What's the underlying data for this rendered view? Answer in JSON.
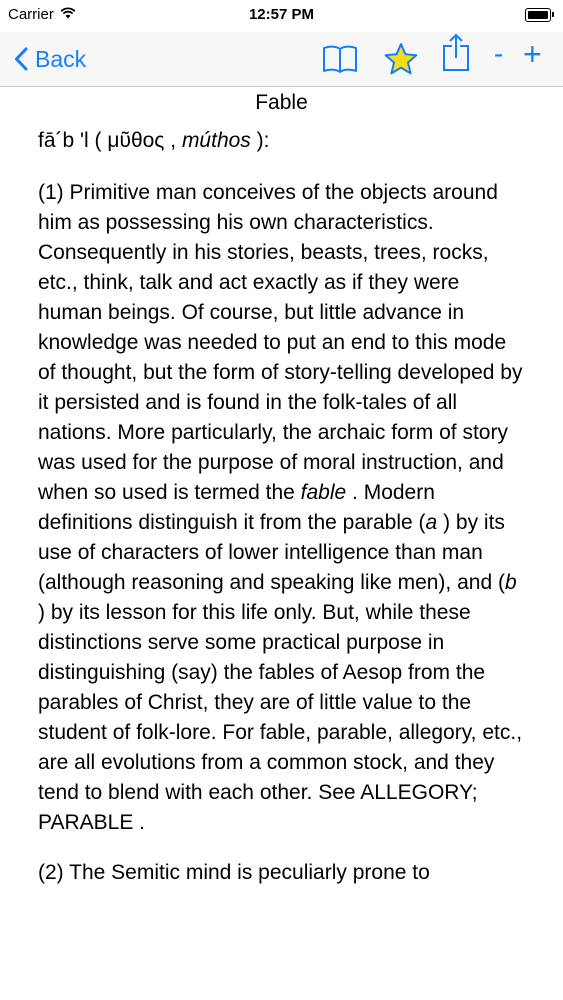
{
  "status_bar": {
    "carrier": "Carrier",
    "time": "12:57 PM"
  },
  "nav": {
    "back_label": "Back",
    "zoom_out": "-",
    "zoom_in": "+"
  },
  "entry": {
    "title": "Fable",
    "pronunciation": {
      "text": "fā´b 'l ( μῦθος , ",
      "italic": "múthos",
      "end": " ):"
    },
    "p1": {
      "part1": "(1) Primitive man conceives of the objects around him as possessing his own characteristics. Consequently in his stories, beasts, trees, rocks, etc., think, talk and act exactly as if they were human beings. Of course, but little advance in knowledge was needed to put an end to this mode of thought, but the form of story-telling developed by it persisted and is found in the folk-tales of all nations. More particularly, the archaic form of story was used for the purpose of moral instruction, and when so used is termed the ",
      "fable": "fable",
      "part2": " . Modern definitions distinguish it from the parable (",
      "a": "a",
      "part3": " ) by its use of characters of lower intelligence than man (although reasoning and speaking like men), and (",
      "b": "b",
      "part4": " ) by its lesson for this life only. But, while these distinctions serve some practical purpose in distinguishing (say) the fables of Aesop from the parables of Christ, they are of little value to the student of folk-lore. For fable, parable, allegory, etc., are all evolutions from a common stock, and they tend to blend with each other. See ",
      "link_allegory": "ALLEGORY",
      "sep": "; ",
      "link_parable": "PARABLE",
      "end": " ."
    },
    "p2": "(2) The Semitic mind is peculiarly prone to"
  },
  "colors": {
    "accent": "#157efb",
    "star": "#f7dc1b"
  }
}
